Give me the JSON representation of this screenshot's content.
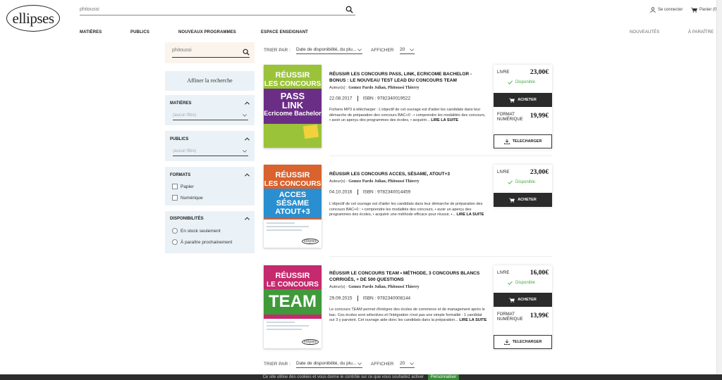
{
  "header": {
    "logo": "ellipses",
    "search_value": "phitoussi",
    "account_label": "Se connecter",
    "cart_label": "Panier (0)"
  },
  "nav": {
    "left": [
      "MATIÈRES",
      "PUBLICS",
      "NOUVEAUX PROGRAMMES",
      "ESPACE ENSEIGNANT"
    ],
    "right": [
      "NOUVEAUTÉS",
      "À PARAÎTRE"
    ]
  },
  "sidebar": {
    "search_value": "phitoussi",
    "affiner": "Affiner la recherche",
    "matieres": {
      "title": "MATIÈRES",
      "placeholder": "(aucun filtre)"
    },
    "publics": {
      "title": "PUBLICS",
      "placeholder": "(aucun filtre)"
    },
    "formats": {
      "title": "FORMATS",
      "options": [
        "Papier",
        "Numérique"
      ]
    },
    "disponibilites": {
      "title": "DISPONIBILITÉS",
      "options": [
        "En stock seulement",
        "À paraître prochainement"
      ]
    }
  },
  "toolbar": {
    "sort_label": "TRIER PAR :",
    "sort_value": "Date de disponibilité, du plu...",
    "show_label": "AFFICHER",
    "show_value": "20"
  },
  "products": [
    {
      "cover": {
        "reussir": "RÉUSSIR",
        "concours": "LES CONCOURS",
        "tag": [
          "PASS",
          "LINK",
          "Ecricome Bachelor"
        ]
      },
      "title": "RÉUSSIR LES CONCOURS PASS, LINK, ECRICOME BACHELOR - BONUS : LE NOUVEAU TEST LEAD DU CONCOURS TEAM",
      "authors_prefix": "Auteur(s) :",
      "authors": "Gomez Pardo Julian, Phitoussi Thierry",
      "date": "22.08.2017",
      "isbn": "ISBN : 9782340019522",
      "desc": "Fichiers MP3 à télécharger : L'objectif de cet ouvrage est d'aider les candidats dans leur démarche de préparation des concours BAC+0 : • comprendre les modalités des concours, • avoir un aperçu des programmes des écoles, • acquérir...",
      "more": "LIRE LA SUITE",
      "livre_label": "LIVRE",
      "livre_price": "23,00€",
      "dispo": "Disponible",
      "acheter": "ACHETER",
      "num_label": "FORMAT NUMÉRIQUE",
      "num_price": "19,99€",
      "telech": "TELECHARGER"
    },
    {
      "cover": {
        "reussir": "RÉUSSIR",
        "concours": "LES CONCOURS",
        "tag": [
          "ACCES",
          "SÉSAME",
          "ATOUT+3"
        ]
      },
      "title": "RÉUSSIR LES CONCOURS ACCES, SÉSAME, ATOUT+3",
      "authors_prefix": "Auteur(s) :",
      "authors": "Gomez Pardo Julian, Phitoussi Thierry",
      "date": "04.10.2016",
      "isbn": "ISBN : 9782340014459",
      "desc": "L'objectif de cet ouvrage est d'aider les candidats dans leur démarche de préparation des concours BAC+0 : • comprendre les modalités des concours, • avoir un aperçu des programmes des écoles, • acquérir une méthode efficace pour réussir, •...",
      "more": "LIRE LA SUITE",
      "livre_label": "LIVRE",
      "livre_price": "23,00€",
      "dispo": "Disponible",
      "acheter": "ACHETER"
    },
    {
      "cover": {
        "reussir": "RÉUSSIR",
        "concours": "LE CONCOURS",
        "tag": [
          "TEAM"
        ]
      },
      "title": "RÉUSSIR LE CONCOURS TEAM • MÉTHODE, 3 CONCOURS BLANCS CORRIGÉS, + DE 500 QUESTIONS",
      "authors_prefix": "Auteur(s) :",
      "authors": "Gomez Pardo Julian, Phitoussi Thierry",
      "date": "29.09.2015",
      "isbn": "ISBN : 9782340008144",
      "desc": "Le concours TEAM permet d'intégrer des écoles de commerce et de management après le bac. Ces écoles sont sélectives et l'intégration n'est pas une simple formalité : 1 candidat sur 3 y parvient. Cet ouvrage aide donc les candidats dans la préparation...",
      "more": "LIRE LA SUITE",
      "livre_label": "LIVRE",
      "livre_price": "16,00€",
      "dispo": "Disponible",
      "acheter": "ACHETER",
      "num_label": "FORMAT NUMÉRIQUE",
      "num_price": "13,99€",
      "telech": "TELECHARGER"
    }
  ],
  "cookie": {
    "text": "Ce site utilise des cookies et vous donne le contrôle sur ce que vous souhaitez activer",
    "button": "Personnaliser"
  },
  "colors": {
    "cover1": "#9bc33a",
    "cover2": "#d9622e",
    "cover3": "#c42a6d",
    "available": "#4aa84a",
    "button_dark": "#2b2b2b",
    "filter_bg": "#eaf2f7",
    "search_bg": "#fbf4ec"
  }
}
